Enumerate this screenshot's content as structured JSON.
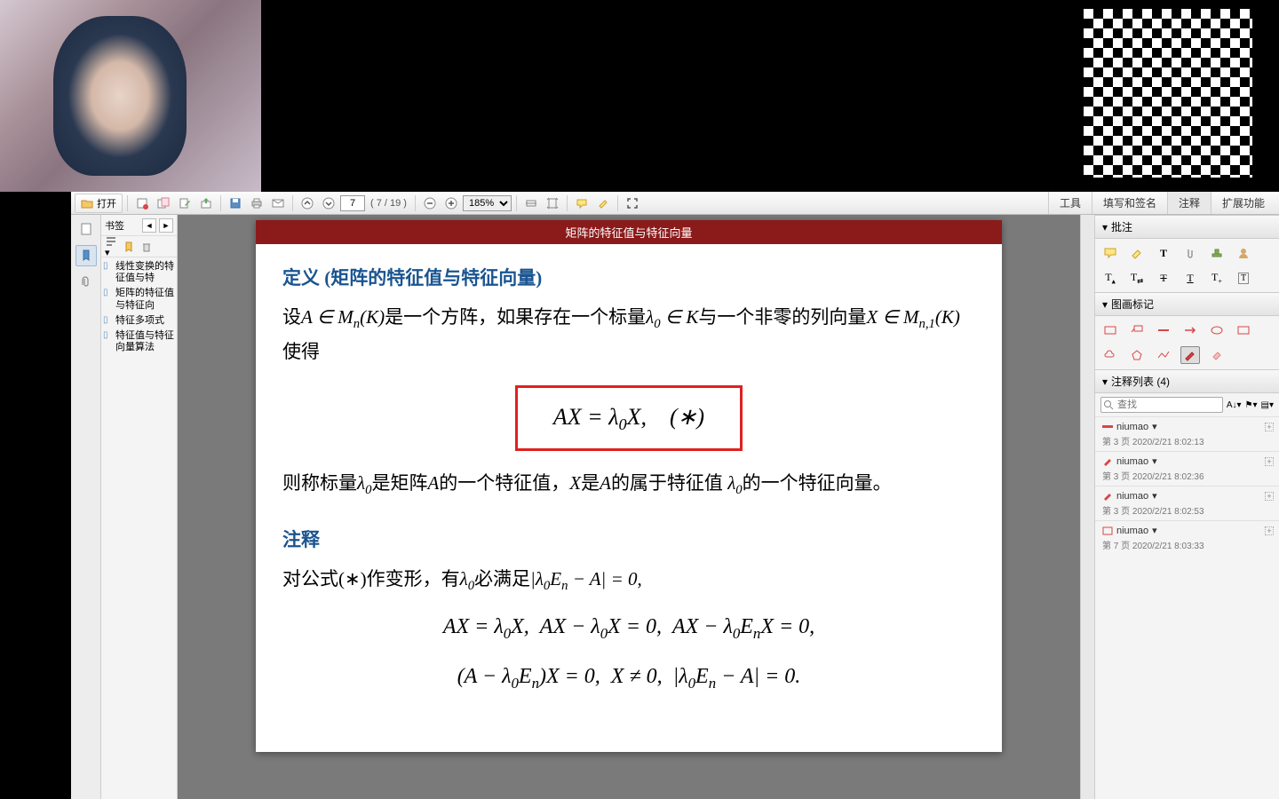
{
  "toolbar": {
    "open_label": "打开",
    "page_current": "7",
    "page_total": "( 7 / 19 )",
    "zoom": "185%"
  },
  "right_tabs": {
    "tools": "工具",
    "fill_sign": "填写和签名",
    "comment": "注释",
    "extend": "扩展功能"
  },
  "bookmarks": {
    "title": "书签",
    "items": [
      "线性变换的特征值与特",
      "矩阵的特征值与特征向",
      "特征多项式",
      "特征值与特征向量算法"
    ]
  },
  "page_header": "矩阵的特征值与特征向量",
  "content": {
    "def_title": "定义 (矩阵的特征值与特征向量)",
    "def_line1_a": "设",
    "def_line1_b": "是一个方阵，如果存在一个标量",
    "def_line1_c": "与一个非零的列向量",
    "def_line1_d": "使得",
    "equation_box": "AX = λ₀X, (∗)",
    "def_line2_a": "则称标量",
    "def_line2_b": "是矩阵",
    "def_line2_c": "的一个特征值，",
    "def_line2_d": "是",
    "def_line2_e": "的属于特征值",
    "def_line2_f": "的一个特征向量。",
    "note_title": "注释",
    "note_line1_a": "对公式(∗)作变形，有",
    "note_line1_b": "必满足",
    "eq2": "AX = λ₀X,  AX − λ₀X = 0,  AX − λ₀EₙX = 0,",
    "eq3": "(A − λ₀Eₙ)X = 0,  X ≠ 0,  |λ₀Eₙ − A| = 0."
  },
  "right_panel": {
    "annot_title": "批注",
    "draw_title": "图画标记",
    "list_title": "注释列表 (4)",
    "search_placeholder": "查找",
    "notes": [
      {
        "user": "niumao",
        "meta": "第 3 页  2020/2/21 8:02:13",
        "kind": "highlight"
      },
      {
        "user": "niumao",
        "meta": "第 3 页  2020/2/21 8:02:36",
        "kind": "pencil"
      },
      {
        "user": "niumao",
        "meta": "第 3 页  2020/2/21 8:02:53",
        "kind": "pencil"
      },
      {
        "user": "niumao",
        "meta": "第 7 页  2020/2/21 8:03:33",
        "kind": "rect"
      }
    ]
  }
}
